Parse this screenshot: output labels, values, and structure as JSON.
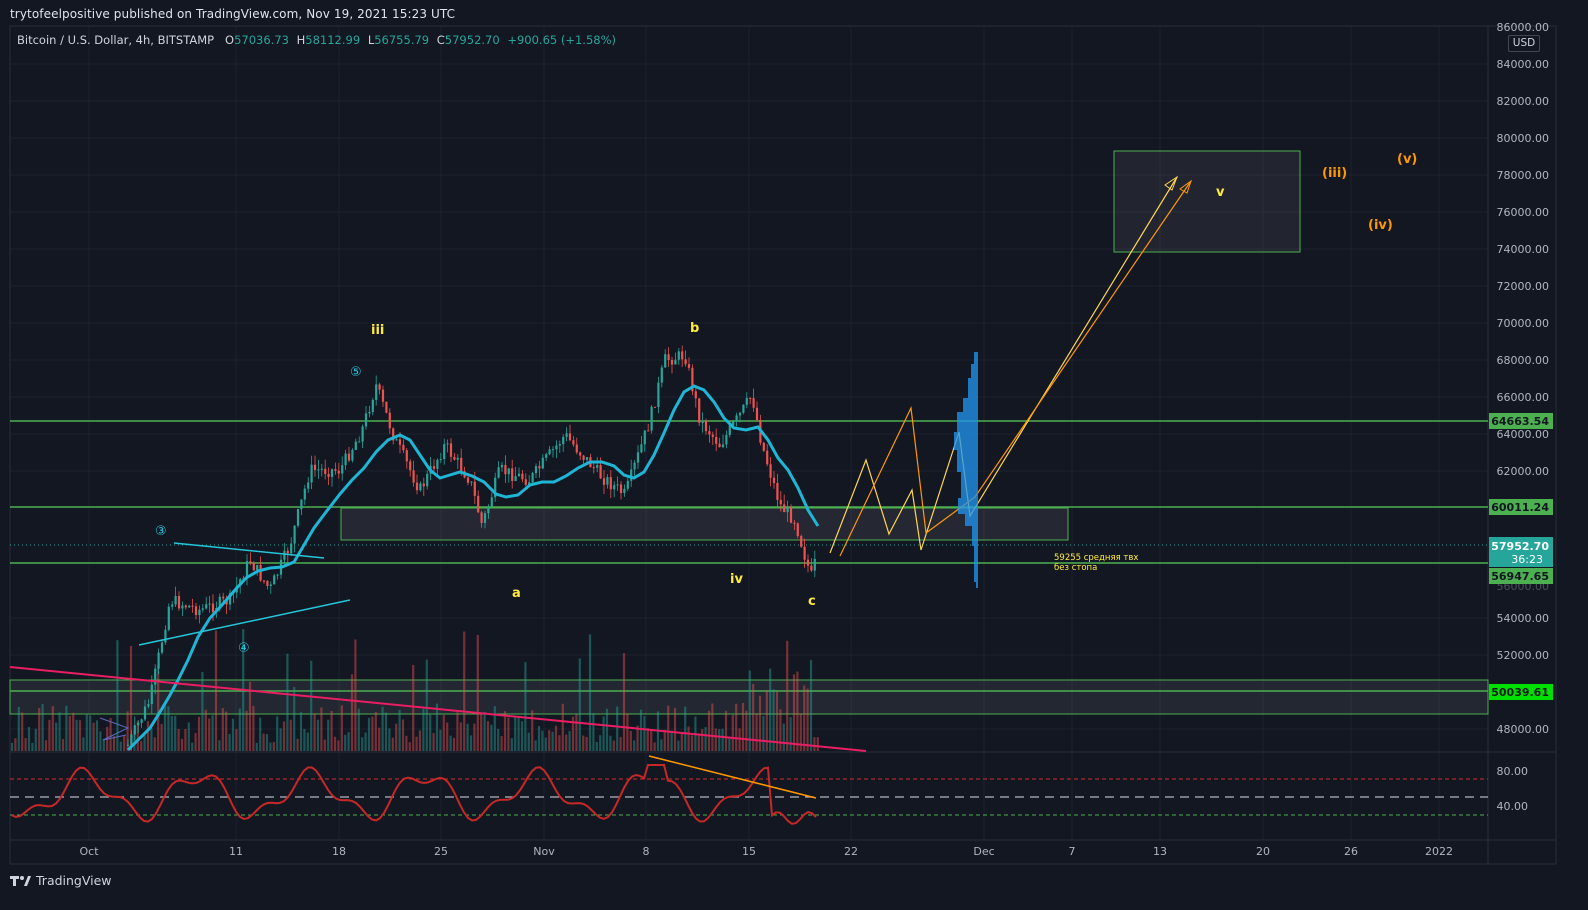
{
  "header": {
    "publisher": "trytofeelpositive published on TradingView.com, Nov 19, 2021 15:23 UTC"
  },
  "legend": {
    "symbol": "Bitcoin / U.S. Dollar, 4h, BITSTAMP",
    "open_label": "O",
    "open": "57036.73",
    "high_label": "H",
    "high": "58112.99",
    "low_label": "L",
    "low": "56755.79",
    "close_label": "C",
    "close": "57952.70",
    "change": "+900.65 (+1.58%)"
  },
  "price_axis": {
    "currency": "USD",
    "ticks": [
      "84000.00",
      "82000.00",
      "80000.00",
      "78000.00",
      "76000.00",
      "74000.00",
      "72000.00",
      "70000.00",
      "68000.00",
      "66000.00",
      "64000.00",
      "62000.00",
      "54000.00",
      "52000.00",
      "48000.00"
    ],
    "top_partial": "86000.00",
    "hidden_partial": "56000.00",
    "labels": {
      "level_1": "64663.54",
      "level_2": "60011.24",
      "last_price": "57952.70",
      "countdown": "36:23",
      "level_3": "56947.65",
      "level_4": "50039.61"
    }
  },
  "oscillator_axis": {
    "ticks": [
      "80.00",
      "40.00"
    ]
  },
  "time_axis": {
    "ticks": [
      "Oct",
      "11",
      "18",
      "25",
      "Nov",
      "8",
      "15",
      "22",
      "Dec",
      "7",
      "13",
      "20",
      "26",
      "2022"
    ]
  },
  "annotations": {
    "wave_iii": "iii",
    "wave_5": "⑤",
    "wave_3": "③",
    "wave_4": "④",
    "wave_a": "a",
    "wave_b": "b",
    "wave_c": "c",
    "wave_iv": "iv",
    "wave_v": "v",
    "wave_iii_paren": "(iii)",
    "wave_iv_paren": "(iv)",
    "wave_v_paren": "(v)",
    "note_line1": "59255 средняя твх",
    "note_line2": "без стопа"
  },
  "colors": {
    "background": "#131722",
    "grid": "#1e222d",
    "up": "#26a69a",
    "down": "#ef5350",
    "level_line": "#4caf50",
    "ma": "#00bcd4",
    "trend_pink": "#e91e63",
    "wave_yellow": "#ffeb3b",
    "wave_orange": "#ff9800",
    "volume_profile": "#2196f3",
    "oscillator": "#d32f2f"
  },
  "footer": {
    "brand": "TradingView",
    "logo_icon": "tradingview-logo-icon"
  }
}
